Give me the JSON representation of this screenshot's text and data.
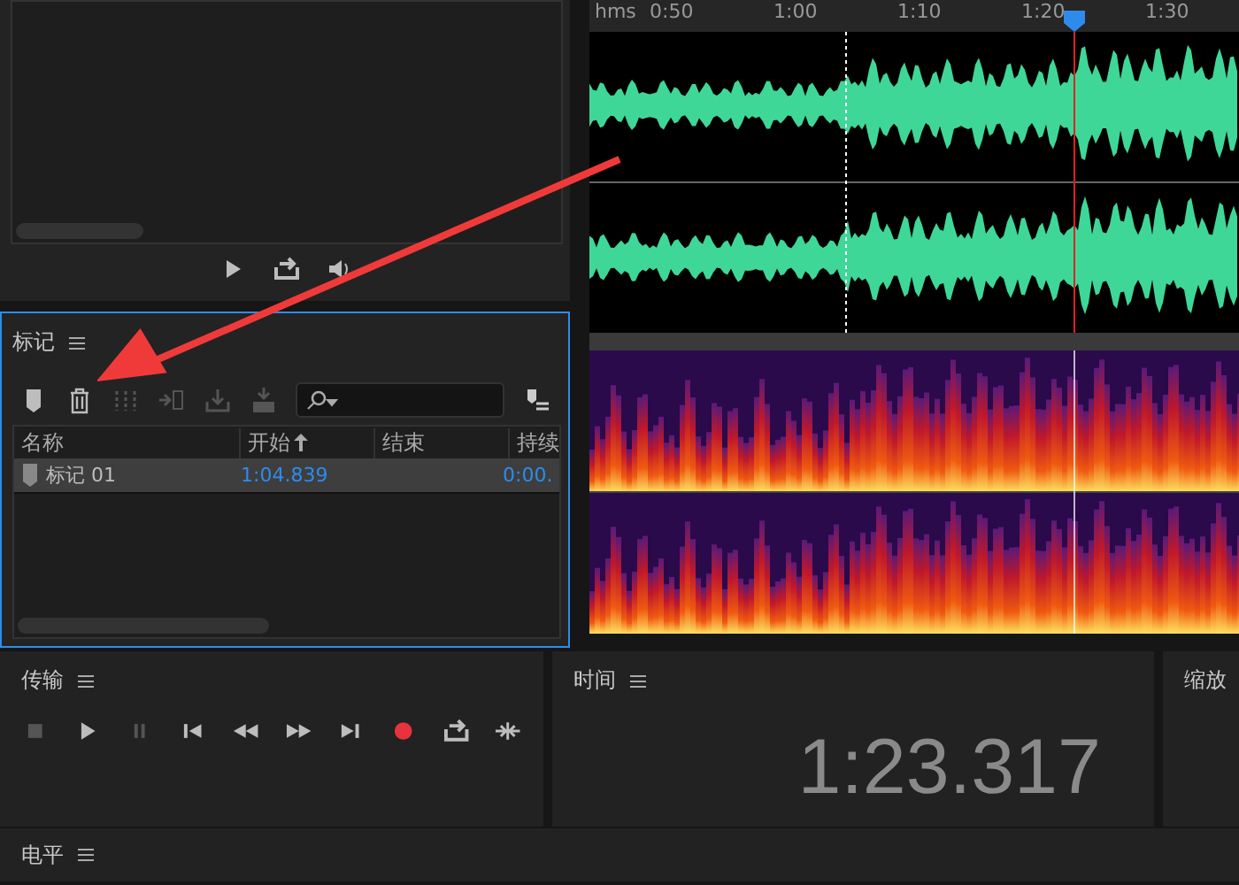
{
  "files_panel": {
    "controls": [
      {
        "kind": "play",
        "disabled": false
      },
      {
        "kind": "loop",
        "disabled": false
      },
      {
        "kind": "volume",
        "disabled": false
      }
    ]
  },
  "markers_panel": {
    "title": "标记",
    "focused": true,
    "toolbar": [
      {
        "kind": "marker",
        "disabled": false
      },
      {
        "kind": "delete",
        "disabled": false
      },
      {
        "kind": "merge",
        "disabled": true
      },
      {
        "kind": "insert",
        "disabled": true
      },
      {
        "kind": "export",
        "disabled": true
      },
      {
        "kind": "batch",
        "disabled": true
      }
    ],
    "columns": [
      {
        "label": "名称",
        "sorted": false
      },
      {
        "label": "开始",
        "sorted": true
      },
      {
        "label": "结束",
        "sorted": false
      },
      {
        "label": "持续",
        "sorted": false
      }
    ],
    "rows": [
      {
        "name": "标记 01",
        "start": "1:04.839",
        "selected": true,
        "duration": "0:00."
      }
    ]
  },
  "editor": {
    "ruler_unit": "hms",
    "ticks": [
      "0:50",
      "1:00",
      "1:10",
      "1:20",
      "1:30"
    ]
  },
  "transport_panel": {
    "title": "传输",
    "buttons": [
      {
        "kind": "stop",
        "disabled": true
      },
      {
        "kind": "play",
        "disabled": false
      },
      {
        "kind": "pause",
        "disabled": true
      },
      {
        "kind": "start",
        "disabled": false
      },
      {
        "kind": "rewind",
        "disabled": false
      },
      {
        "kind": "forward",
        "disabled": false
      },
      {
        "kind": "end",
        "disabled": false
      },
      {
        "kind": "record",
        "disabled": false
      },
      {
        "kind": "loop",
        "disabled": false
      },
      {
        "kind": "skip",
        "disabled": false
      }
    ]
  },
  "time_panel": {
    "title": "时间",
    "time": "1:23.317"
  },
  "zoom_panel": {
    "title": "缩放"
  },
  "level_panel": {
    "title": "电平"
  }
}
